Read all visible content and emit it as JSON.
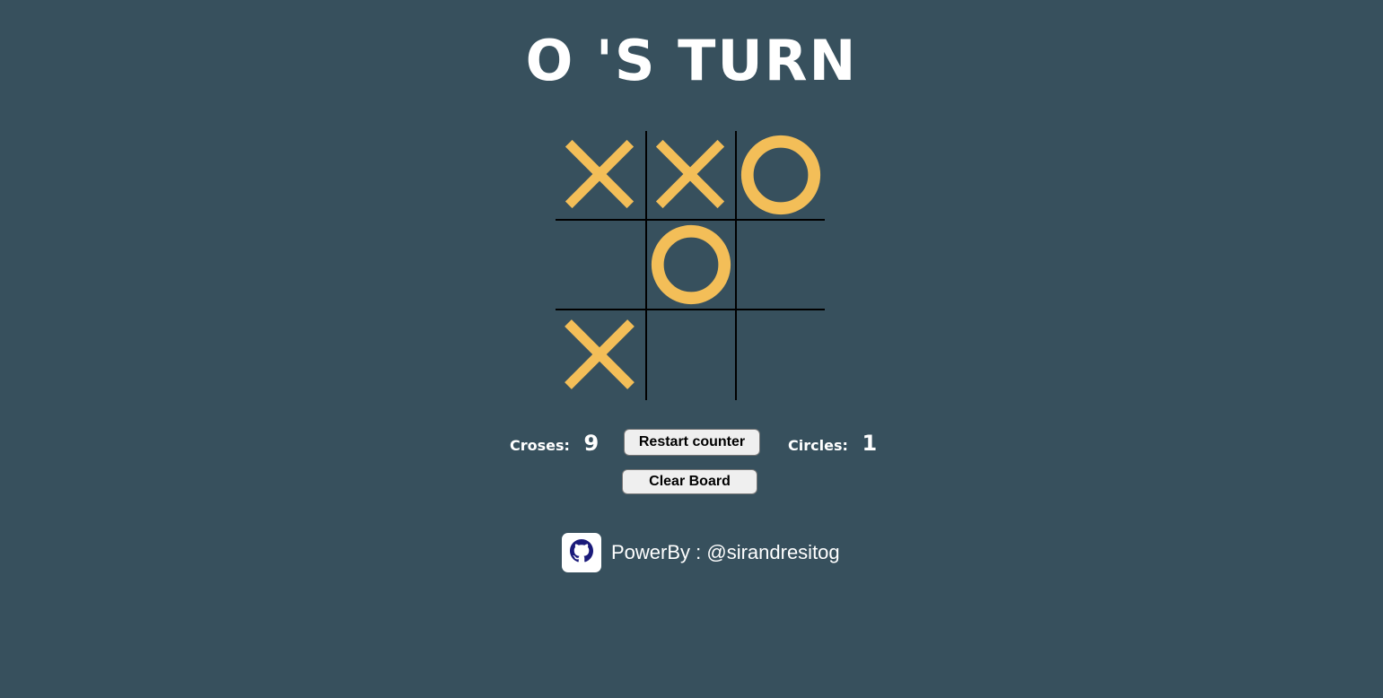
{
  "title": "O 'S TURN",
  "board": {
    "cells": [
      "X",
      "X",
      "O",
      "",
      "O",
      "",
      "X",
      "",
      ""
    ]
  },
  "colors": {
    "background": "#37505d",
    "mark": "#f3be58",
    "grid_line": "#000000",
    "text": "#ffffff"
  },
  "scores": {
    "crosses_label": "Croses:",
    "crosses_value": "9",
    "circles_label": "Circles:",
    "circles_value": "1"
  },
  "buttons": {
    "restart_label": "Restart counter",
    "clear_label": "Clear Board"
  },
  "footer": {
    "icon": "github-icon",
    "text": "PowerBy : @sirandresitog"
  }
}
